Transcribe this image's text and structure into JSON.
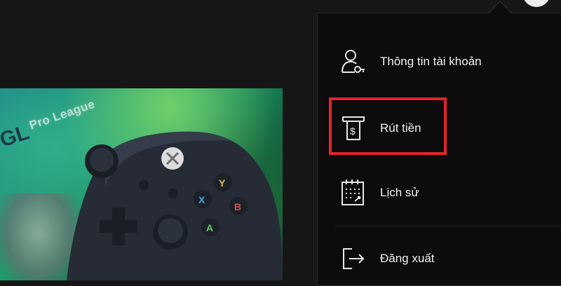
{
  "banner": {
    "league_text": "Pro League",
    "logo_text": "GL"
  },
  "menu": {
    "items": [
      {
        "label": "Thông tin tài khoản",
        "icon": "user-account-icon"
      },
      {
        "label": "Rút tiền",
        "icon": "atm-withdraw-icon"
      },
      {
        "label": "Lịch sử",
        "icon": "calendar-history-icon"
      },
      {
        "label": "Đăng xuất",
        "icon": "logout-icon"
      }
    ]
  },
  "colors": {
    "menu_bg": "#0d0b0c",
    "page_bg": "#161616",
    "highlight": "#e0252c",
    "text": "#f2f2f2"
  }
}
